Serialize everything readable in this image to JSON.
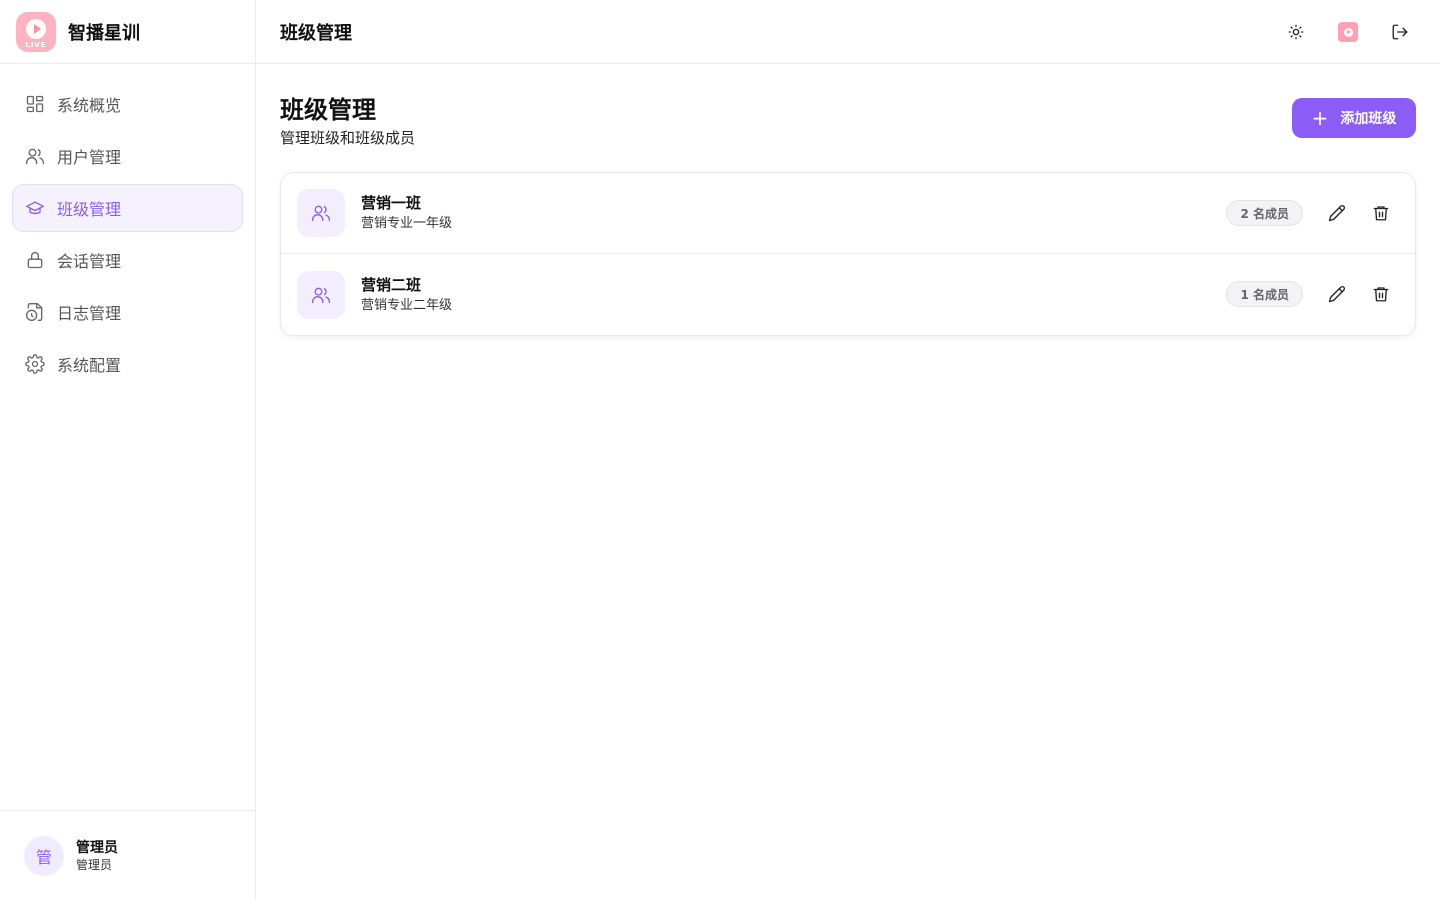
{
  "brand": {
    "name": "智播星训",
    "logo_text": "LIVE"
  },
  "sidebar": {
    "items": [
      {
        "label": "系统概览",
        "icon": "dashboard-icon"
      },
      {
        "label": "用户管理",
        "icon": "users-icon"
      },
      {
        "label": "班级管理",
        "icon": "graduation-cap-icon",
        "active": true
      },
      {
        "label": "会话管理",
        "icon": "lock-icon"
      },
      {
        "label": "日志管理",
        "icon": "file-clock-icon"
      },
      {
        "label": "系统配置",
        "icon": "gear-icon"
      }
    ]
  },
  "user": {
    "avatar": "管",
    "name": "管理员",
    "role": "管理员"
  },
  "topbar": {
    "title": "班级管理",
    "icons": [
      "sun-icon",
      "app-logo-icon",
      "logout-icon"
    ]
  },
  "page": {
    "title": "班级管理",
    "subtitle": "管理班级和班级成员",
    "add_button": "添加班级"
  },
  "classes": [
    {
      "name": "营销一班",
      "description": "营销专业一年级",
      "members": "2 名成员"
    },
    {
      "name": "营销二班",
      "description": "营销专业二年级",
      "members": "1 名成员"
    }
  ],
  "colors": {
    "accent": "#8b5cf6",
    "accent_light": "#f3eeff",
    "logo_pink": "#ffb3c1"
  }
}
